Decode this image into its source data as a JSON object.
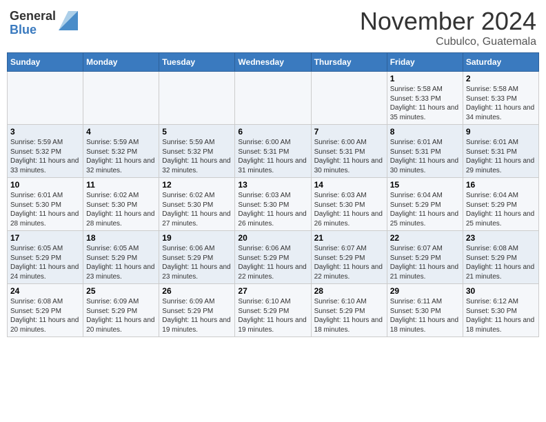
{
  "header": {
    "logo_general": "General",
    "logo_blue": "Blue",
    "month_title": "November 2024",
    "location": "Cubulco, Guatemala"
  },
  "weekdays": [
    "Sunday",
    "Monday",
    "Tuesday",
    "Wednesday",
    "Thursday",
    "Friday",
    "Saturday"
  ],
  "weeks": [
    [
      {
        "day": "",
        "info": ""
      },
      {
        "day": "",
        "info": ""
      },
      {
        "day": "",
        "info": ""
      },
      {
        "day": "",
        "info": ""
      },
      {
        "day": "",
        "info": ""
      },
      {
        "day": "1",
        "info": "Sunrise: 5:58 AM\nSunset: 5:33 PM\nDaylight: 11 hours and 35 minutes."
      },
      {
        "day": "2",
        "info": "Sunrise: 5:58 AM\nSunset: 5:33 PM\nDaylight: 11 hours and 34 minutes."
      }
    ],
    [
      {
        "day": "3",
        "info": "Sunrise: 5:59 AM\nSunset: 5:32 PM\nDaylight: 11 hours and 33 minutes."
      },
      {
        "day": "4",
        "info": "Sunrise: 5:59 AM\nSunset: 5:32 PM\nDaylight: 11 hours and 32 minutes."
      },
      {
        "day": "5",
        "info": "Sunrise: 5:59 AM\nSunset: 5:32 PM\nDaylight: 11 hours and 32 minutes."
      },
      {
        "day": "6",
        "info": "Sunrise: 6:00 AM\nSunset: 5:31 PM\nDaylight: 11 hours and 31 minutes."
      },
      {
        "day": "7",
        "info": "Sunrise: 6:00 AM\nSunset: 5:31 PM\nDaylight: 11 hours and 30 minutes."
      },
      {
        "day": "8",
        "info": "Sunrise: 6:01 AM\nSunset: 5:31 PM\nDaylight: 11 hours and 30 minutes."
      },
      {
        "day": "9",
        "info": "Sunrise: 6:01 AM\nSunset: 5:31 PM\nDaylight: 11 hours and 29 minutes."
      }
    ],
    [
      {
        "day": "10",
        "info": "Sunrise: 6:01 AM\nSunset: 5:30 PM\nDaylight: 11 hours and 28 minutes."
      },
      {
        "day": "11",
        "info": "Sunrise: 6:02 AM\nSunset: 5:30 PM\nDaylight: 11 hours and 28 minutes."
      },
      {
        "day": "12",
        "info": "Sunrise: 6:02 AM\nSunset: 5:30 PM\nDaylight: 11 hours and 27 minutes."
      },
      {
        "day": "13",
        "info": "Sunrise: 6:03 AM\nSunset: 5:30 PM\nDaylight: 11 hours and 26 minutes."
      },
      {
        "day": "14",
        "info": "Sunrise: 6:03 AM\nSunset: 5:30 PM\nDaylight: 11 hours and 26 minutes."
      },
      {
        "day": "15",
        "info": "Sunrise: 6:04 AM\nSunset: 5:29 PM\nDaylight: 11 hours and 25 minutes."
      },
      {
        "day": "16",
        "info": "Sunrise: 6:04 AM\nSunset: 5:29 PM\nDaylight: 11 hours and 25 minutes."
      }
    ],
    [
      {
        "day": "17",
        "info": "Sunrise: 6:05 AM\nSunset: 5:29 PM\nDaylight: 11 hours and 24 minutes."
      },
      {
        "day": "18",
        "info": "Sunrise: 6:05 AM\nSunset: 5:29 PM\nDaylight: 11 hours and 23 minutes."
      },
      {
        "day": "19",
        "info": "Sunrise: 6:06 AM\nSunset: 5:29 PM\nDaylight: 11 hours and 23 minutes."
      },
      {
        "day": "20",
        "info": "Sunrise: 6:06 AM\nSunset: 5:29 PM\nDaylight: 11 hours and 22 minutes."
      },
      {
        "day": "21",
        "info": "Sunrise: 6:07 AM\nSunset: 5:29 PM\nDaylight: 11 hours and 22 minutes."
      },
      {
        "day": "22",
        "info": "Sunrise: 6:07 AM\nSunset: 5:29 PM\nDaylight: 11 hours and 21 minutes."
      },
      {
        "day": "23",
        "info": "Sunrise: 6:08 AM\nSunset: 5:29 PM\nDaylight: 11 hours and 21 minutes."
      }
    ],
    [
      {
        "day": "24",
        "info": "Sunrise: 6:08 AM\nSunset: 5:29 PM\nDaylight: 11 hours and 20 minutes."
      },
      {
        "day": "25",
        "info": "Sunrise: 6:09 AM\nSunset: 5:29 PM\nDaylight: 11 hours and 20 minutes."
      },
      {
        "day": "26",
        "info": "Sunrise: 6:09 AM\nSunset: 5:29 PM\nDaylight: 11 hours and 19 minutes."
      },
      {
        "day": "27",
        "info": "Sunrise: 6:10 AM\nSunset: 5:29 PM\nDaylight: 11 hours and 19 minutes."
      },
      {
        "day": "28",
        "info": "Sunrise: 6:10 AM\nSunset: 5:29 PM\nDaylight: 11 hours and 18 minutes."
      },
      {
        "day": "29",
        "info": "Sunrise: 6:11 AM\nSunset: 5:30 PM\nDaylight: 11 hours and 18 minutes."
      },
      {
        "day": "30",
        "info": "Sunrise: 6:12 AM\nSunset: 5:30 PM\nDaylight: 11 hours and 18 minutes."
      }
    ]
  ]
}
